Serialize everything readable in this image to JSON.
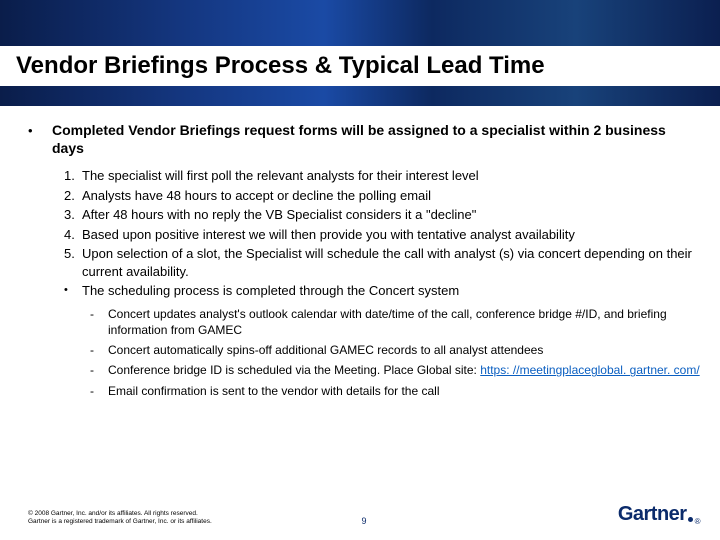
{
  "title": "Vendor Briefings Process & Typical Lead Time",
  "lead": "Completed Vendor Briefings request forms will be assigned to a specialist within 2 business days",
  "steps": [
    "The specialist will first poll the relevant analysts for their interest level",
    "Analysts have  48 hours to accept or decline the polling email",
    "After 48 hours with no reply the VB Specialist considers it a \"decline\"",
    "Based upon positive interest we will then provide you with tentative analyst availability",
    "Upon selection of a slot, the Specialist will schedule the call with analyst (s) via concert depending on their current availability."
  ],
  "sub_bullet": "The scheduling process is completed through the Concert system",
  "dashes": [
    "Concert updates analyst's outlook calendar with date/time of the call, conference bridge #/ID, and briefing information from GAMEC",
    "Concert automatically spins-off additional GAMEC records to all analyst attendees",
    "Conference bridge ID is scheduled via the Meeting. Place Global site: ",
    "Email confirmation is sent to the vendor with details for the call"
  ],
  "bridge_link": "https: //meetingplaceglobal. gartner. com/",
  "copyright1": "© 2008 Gartner, Inc. and/or its affiliates. All rights reserved.",
  "copyright2": "Gartner is a registered trademark of Gartner, Inc. or its affiliates.",
  "page_number": "9",
  "logo_text": "Gartner"
}
